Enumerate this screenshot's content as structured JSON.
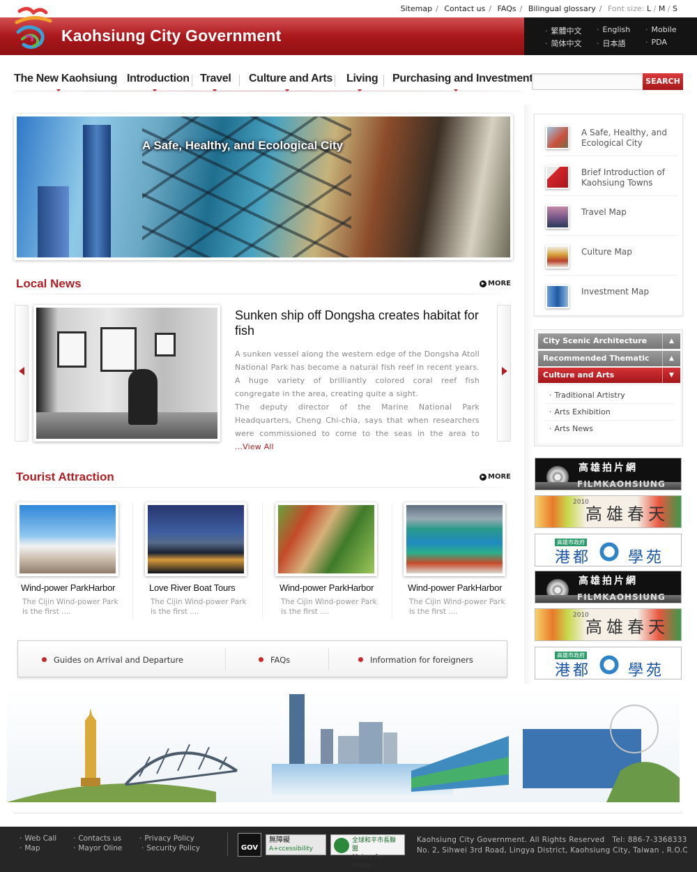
{
  "util_links": {
    "sitemap": "Sitemap",
    "contact": "Contact us",
    "faqs": "FAQs",
    "glossary": "Bilingual glossary",
    "font_size_label": "Font size:",
    "font_l": "L",
    "font_m": "M",
    "font_s": "S"
  },
  "brand": {
    "title": "Kaohsiung City Government"
  },
  "languages": {
    "trad_chinese": "繁體中文",
    "english": "English",
    "mobile": "Mobile",
    "simp_chinese": "简体中文",
    "japanese": "日本語",
    "pda": "PDA"
  },
  "nav": [
    "The New Kaohsiung",
    "Introduction",
    "Travel",
    "Culture and Arts",
    "Living",
    "Purchasing and Investment"
  ],
  "search": {
    "placeholder": "",
    "button": "SEARCH"
  },
  "hero": {
    "caption": "A Safe, Healthy, and Ecological City"
  },
  "local_news": {
    "heading": "Local News",
    "more": "MORE",
    "title": "Sunken ship off Dongsha creates habitat for fish",
    "body_1": "A sunken vessel along the western edge of the Dongsha Atoll National Park has become a natural fish reef in recent years. A huge variety of brilliantly colored coral reef fish congregate in the area, creating quite a sight.",
    "body_2": "The deputy director of the Marine National Park Headquarters, Cheng Chi-chia, says that when researchers were commissioned to come to the seas in the area to",
    "view_all": "...View All"
  },
  "tourist": {
    "heading": "Tourist Attraction",
    "more": "MORE",
    "cards": [
      {
        "title": "Wind-power ParkHarbor",
        "desc": "The Cijin Wind-power Park is the first ...."
      },
      {
        "title": "Love River Boat Tours",
        "desc": "The Cijin Wind-power Park is the first ...."
      },
      {
        "title": "Wind-power ParkHarbor",
        "desc": "The Cijin Wind-power Park is the first ...."
      },
      {
        "title": "Wind-power ParkHarbor",
        "desc": "The Cijin Wind-power Park is the first ...."
      }
    ]
  },
  "bottom_links": [
    "Guides on Arrival and Departure",
    "FAQs",
    "Information for foreigners"
  ],
  "quick_links": [
    "A Safe, Healthy, and Ecological City",
    "Brief Introduction of Kaohsiung Towns",
    "Travel Map",
    "Culture Map",
    "Investment Map"
  ],
  "accordion": {
    "headers": [
      "City Scenic Architecture",
      "Recommended Thematic",
      "Culture and Arts"
    ],
    "items": [
      "Traditional Artistry",
      "Arts Exhibition",
      "Arts News"
    ]
  },
  "banners": {
    "film_zh": "高雄拍片網",
    "film_en": "FILMKAOHSIUNG",
    "spring_zh": "高雄春天",
    "spring_year": "2010",
    "harbor_tag": "高雄市政府",
    "harbor_zh_1": "港都",
    "harbor_zh_2": "學苑"
  },
  "footer": {
    "links": [
      "Web Call",
      "Contacts us",
      "Privacy Policy",
      "Map",
      "Mayor Oline",
      "Security Policy"
    ],
    "copyright": "Kaohsiung City Government. All Rights Reserved",
    "tel": "Tel: 886-7-3368333",
    "address": "No. 2, Sihwei 3rd Road, Lingya District, Kaohsiung City, Taiwan , R.O.C",
    "badge_gov": "GOV",
    "badge_access_zh": "無障礙",
    "badge_access_en": "A+ccessibility",
    "badge_peace_zh": "全球和平市長聯盟",
    "badge_peace_en": "Majors for Peace"
  },
  "colors": {
    "brand_red": "#b01e22",
    "header_dark": "#141414",
    "footer_bg": "#262626"
  }
}
